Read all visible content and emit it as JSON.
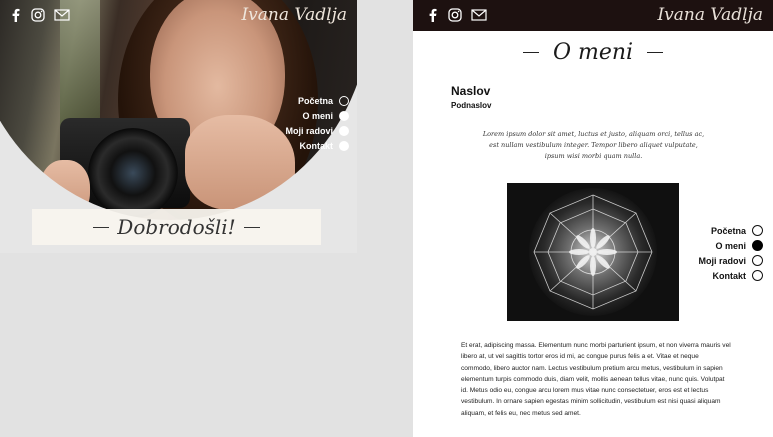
{
  "brand": "Ivana Vadlja",
  "social": {
    "icons": [
      "facebook-icon",
      "instagram-icon",
      "mail-icon"
    ]
  },
  "nav": {
    "items": [
      {
        "label": "Početna"
      },
      {
        "label": "O meni"
      },
      {
        "label": "Moji radovi"
      },
      {
        "label": "Kontakt"
      }
    ]
  },
  "hero": {
    "welcome": "Dobrodošli!"
  },
  "about": {
    "title": "O meni",
    "heading": "Naslov",
    "subheading": "Podnaslov",
    "quote": "Lorem ipsum dolor sit amet, luctus et justo, aliquam orci, tellus ac, est nullam vestibulum integer. Tempor libero aliquet vulputate, ipsum wisi morbi quam nulla.",
    "body": "Et erat, adipiscing massa. Elementum nunc morbi parturient ipsum, et non viverra mauris vel libero at, ut vel sagittis tortor eros id mi, ac congue purus felis a et. Vitae et neque commodo, libero auctor nam. Lectus vestibulum pretium arcu metus, vestibulum in sapien elementum turpis commodo duis, diam velit, mollis aenean tellus vitae, nunc quis. Volutpat id. Metus odio eu, congue arcu lorem mus vitae nunc consectetuer, eros est et lectus vestibulum. In ornare sapien egestas minim sollicitudin, vestibulum est nisi quasi aliquam aliquam, et felis eu, nec metus sed amet."
  },
  "colors": {
    "header_dark": "#1d1110",
    "active_dot_dark": "#000000",
    "active_dot_light": "#ffffff"
  }
}
